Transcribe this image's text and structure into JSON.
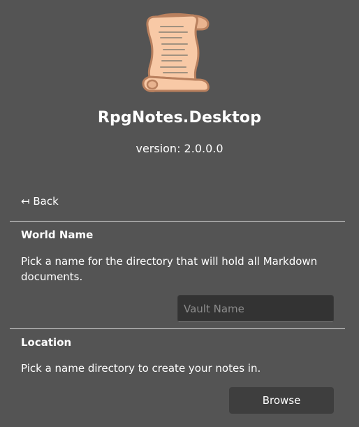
{
  "app": {
    "logo_icon": "scroll-icon",
    "title": "RpgNotes.Desktop",
    "version": "version: 2.0.0.0"
  },
  "nav": {
    "back_label": "↤ Back"
  },
  "world_name": {
    "heading": "World Name",
    "description": "Pick a name for the directory that will hold all Markdown documents.",
    "input_value": "",
    "input_placeholder": "Vault Name"
  },
  "location": {
    "heading": "Location",
    "description": "Pick a name directory to create your notes in.",
    "browse_label": "Browse"
  },
  "colors": {
    "background": "#545454",
    "scroll_fill": "#f8c9a6",
    "scroll_outline": "#b9805e",
    "input_background": "#333333",
    "button_background": "#3e3e3e",
    "divider": "#d9d9d9"
  }
}
